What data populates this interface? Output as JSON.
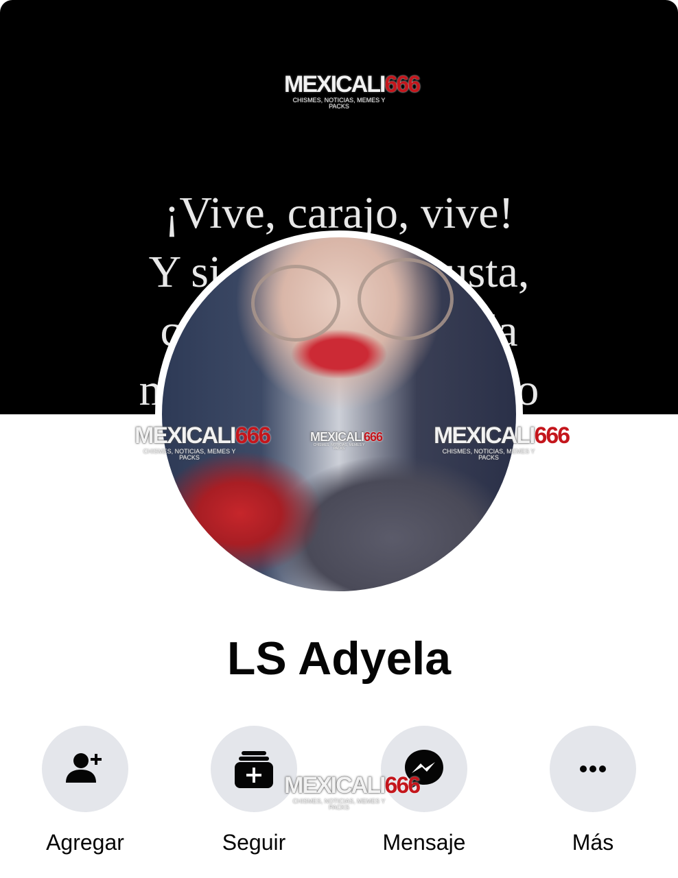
{
  "cover": {
    "quote_lines": [
      "¡Vive, carajo, vive!",
      "Y si algo no te gusta,",
      "cámbialo. Y si te da",
      "miedo, hazlo con algo"
    ]
  },
  "watermark": {
    "brand": "MEXICALI",
    "number": "666",
    "tagline": "CHISMES, NOTICIAS, MEMES Y PACKS"
  },
  "profile": {
    "name": "LS Adyela"
  },
  "actions": [
    {
      "label": "Agregar",
      "icon": "add-friend-icon"
    },
    {
      "label": "Seguir",
      "icon": "follow-icon"
    },
    {
      "label": "Mensaje",
      "icon": "messenger-icon"
    },
    {
      "label": "Más",
      "icon": "more-dots-icon"
    }
  ],
  "colors": {
    "button_bg": "#e4e6eb",
    "icon": "#050505",
    "brand_red": "#c4161c",
    "cover_bg": "#000000"
  }
}
